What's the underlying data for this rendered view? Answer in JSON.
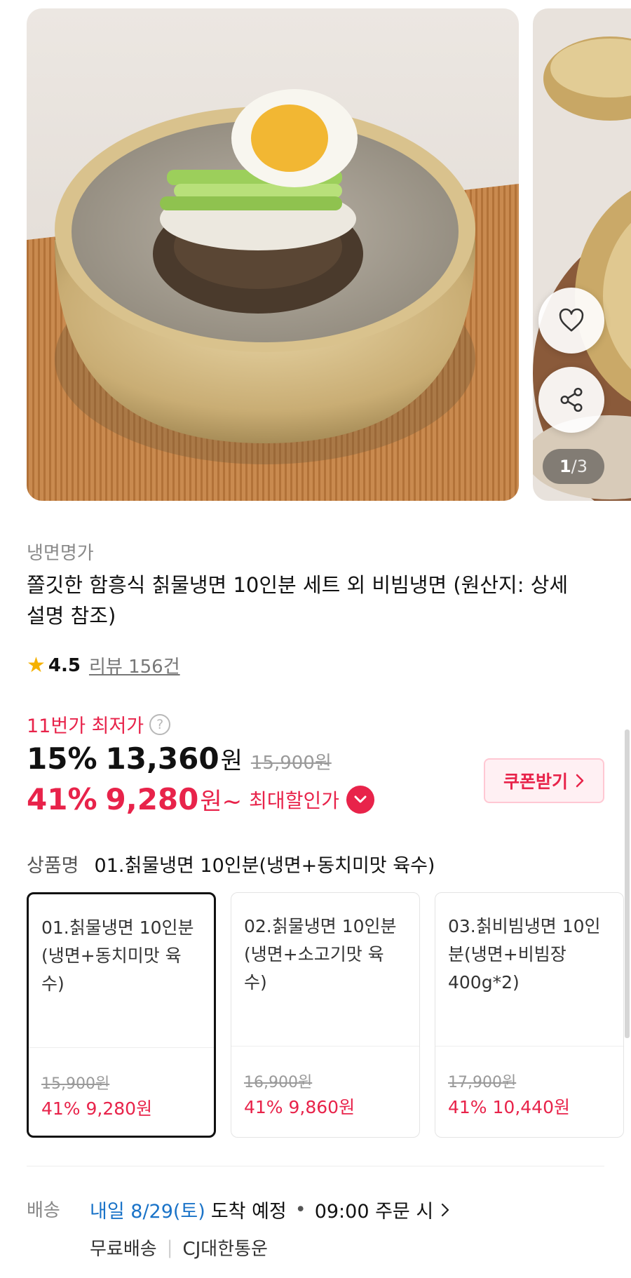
{
  "gallery": {
    "current": "1",
    "total": "/3"
  },
  "product": {
    "store": "냉면명가",
    "title": "쫄깃한 함흥식 칡물냉면 10인분 세트 외 비빔냉면 (원산지: 상세설명 참조)",
    "rating": "4.5",
    "reviews": "리뷰 156건"
  },
  "pricing": {
    "lowest_label": "11번가 최저가",
    "help_icon": "?",
    "discount_pct": "15%",
    "discount_price": "13,360",
    "won": "원",
    "original_price": "15,900원",
    "max_pct": "41%",
    "max_price": "9,280",
    "max_suffix": "원~",
    "max_label": "최대할인가",
    "coupon_label": "쿠폰받기",
    "accent_color": "#e8234a"
  },
  "options": {
    "label": "상품명",
    "selected_value": "01.칡물냉면 10인분(냉면+동치미맛 육수)",
    "cards": [
      {
        "name": "01.칡물냉면 10인분(냉면+동치미맛 육수)",
        "original": "15,900원",
        "sale": "41% 9,280원",
        "selected": true
      },
      {
        "name": "02.칡물냉면 10인분(냉면+소고기맛 육수)",
        "original": "16,900원",
        "sale": "41% 9,860원",
        "selected": false
      },
      {
        "name": "03.칡비빔냉면 10인분(냉면+비빔장 400g*2)",
        "original": "17,900원",
        "sale": "41% 10,440원",
        "selected": false
      }
    ]
  },
  "shipping": {
    "label": "배송",
    "date": "내일 8/29(토)",
    "arrival": "도착 예정",
    "dot": "•",
    "cutoff": "09:00 주문 시",
    "free": "무료배송",
    "divider": "|",
    "carrier": "CJ대한통운",
    "date_color": "#1a73c8"
  }
}
